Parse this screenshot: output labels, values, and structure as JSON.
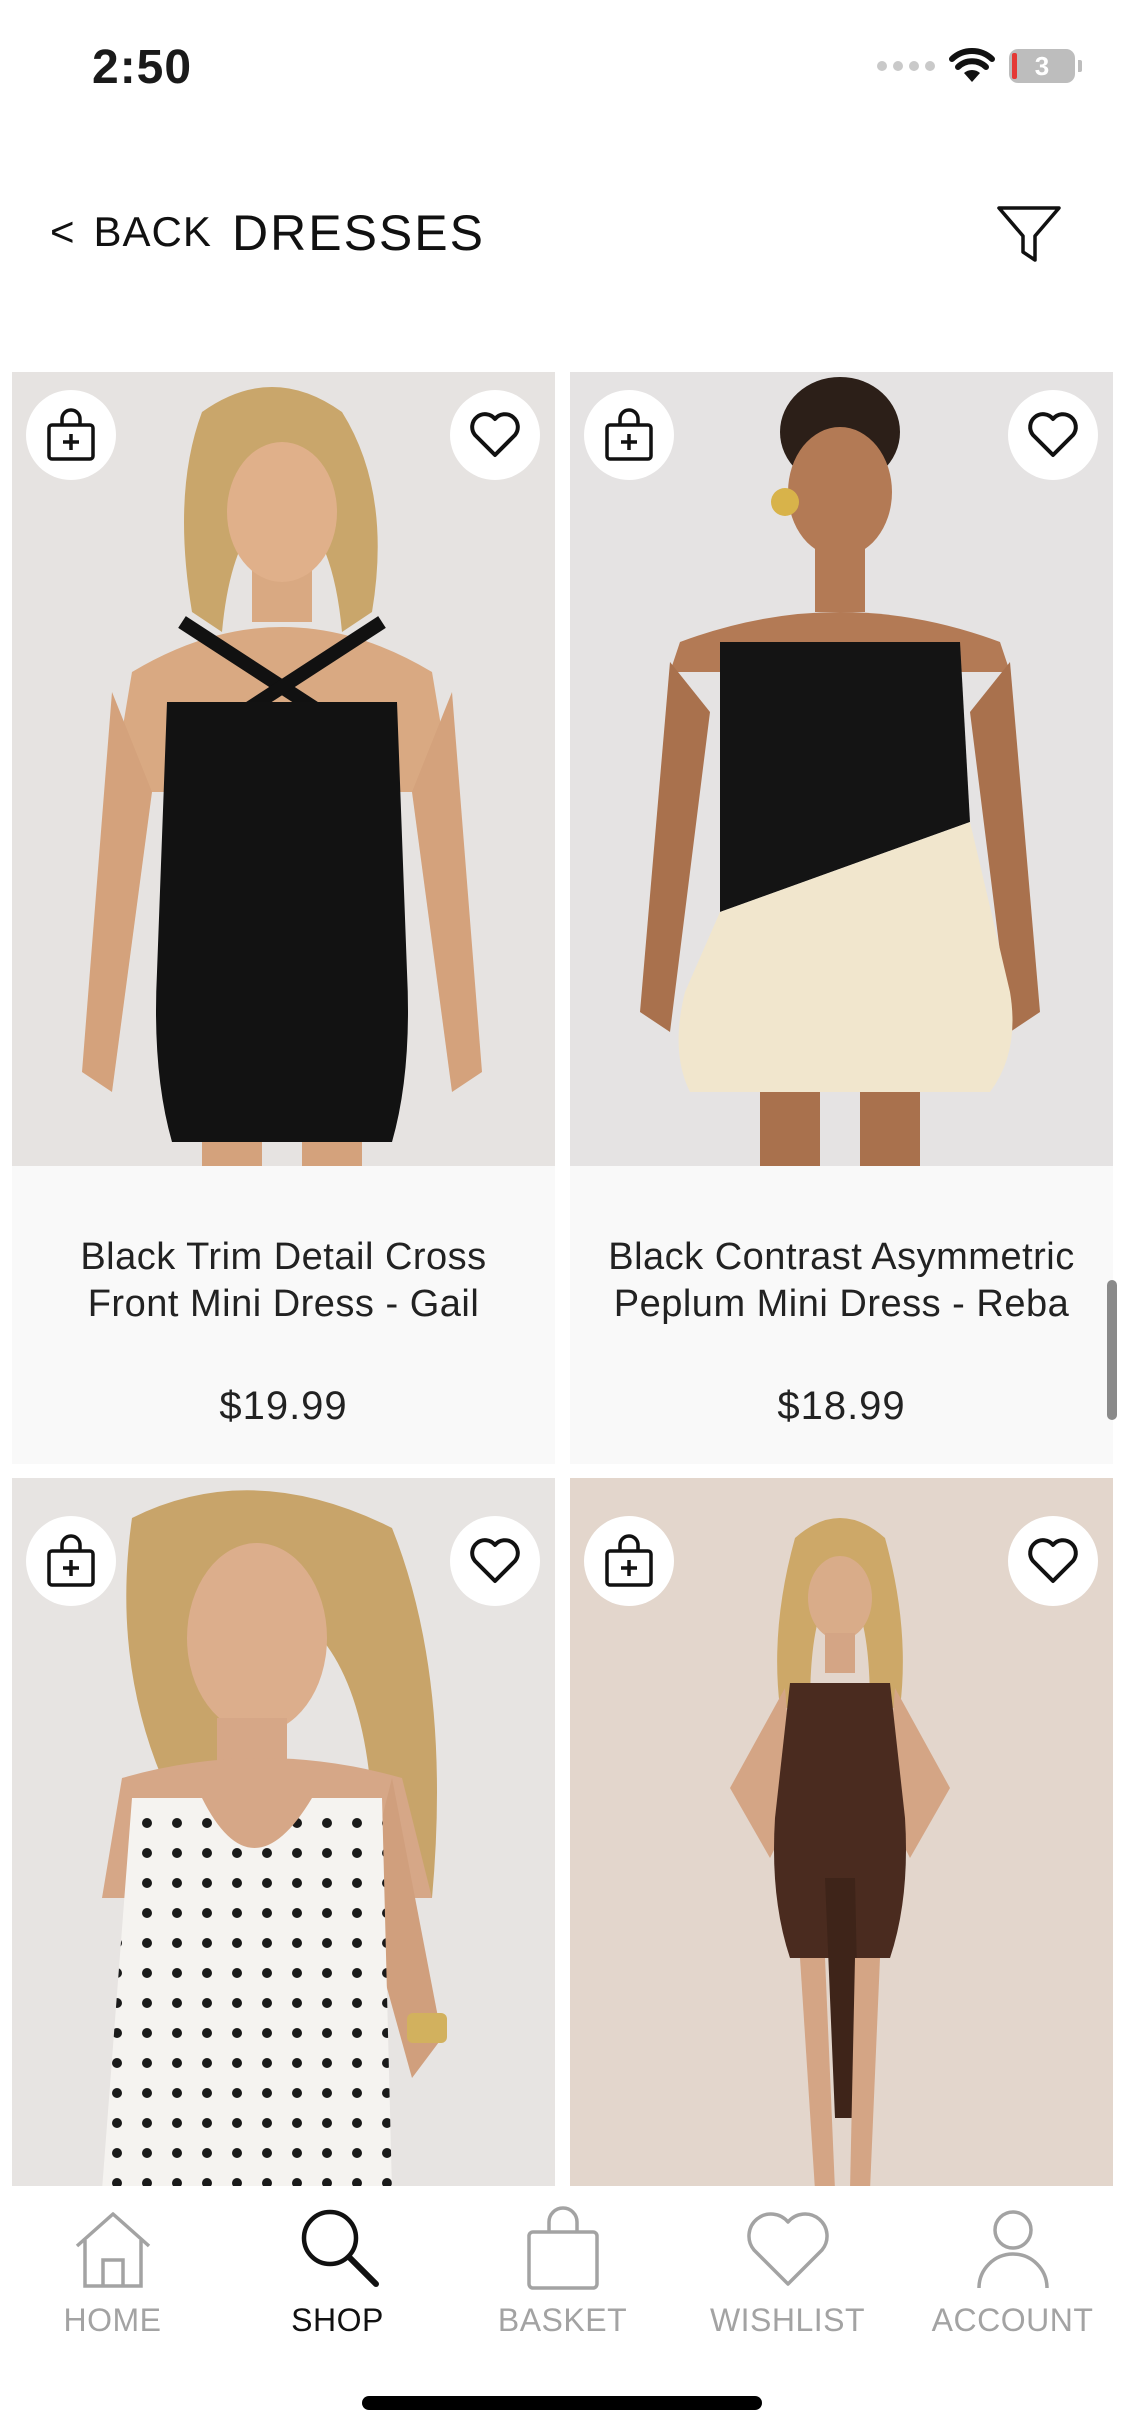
{
  "status_bar": {
    "time": "2:50",
    "battery_level": "3"
  },
  "header": {
    "back_label": "BACK",
    "back_chevron": "<",
    "title": "DRESSES",
    "filter_icon": "filter-icon"
  },
  "products": [
    {
      "name": "Black Trim Detail Cross Front Mini Dress - Gail",
      "price": "$19.99"
    },
    {
      "name": "Black Contrast Asymmetric Peplum Mini Dress - Reba",
      "price": "$18.99"
    },
    {
      "name": "",
      "price": ""
    },
    {
      "name": "",
      "price": ""
    }
  ],
  "tabs": [
    {
      "label": "HOME",
      "icon": "home-icon",
      "active": false
    },
    {
      "label": "SHOP",
      "icon": "search-icon",
      "active": true
    },
    {
      "label": "BASKET",
      "icon": "bag-icon",
      "active": false
    },
    {
      "label": "WISHLIST",
      "icon": "heart-icon",
      "active": false
    },
    {
      "label": "ACCOUNT",
      "icon": "person-icon",
      "active": false
    }
  ],
  "colors": {
    "accent": "#111111",
    "inactive_tab": "#a3a3a3",
    "card_bg": "#f9f9f9",
    "battery_low": "#e53935"
  }
}
